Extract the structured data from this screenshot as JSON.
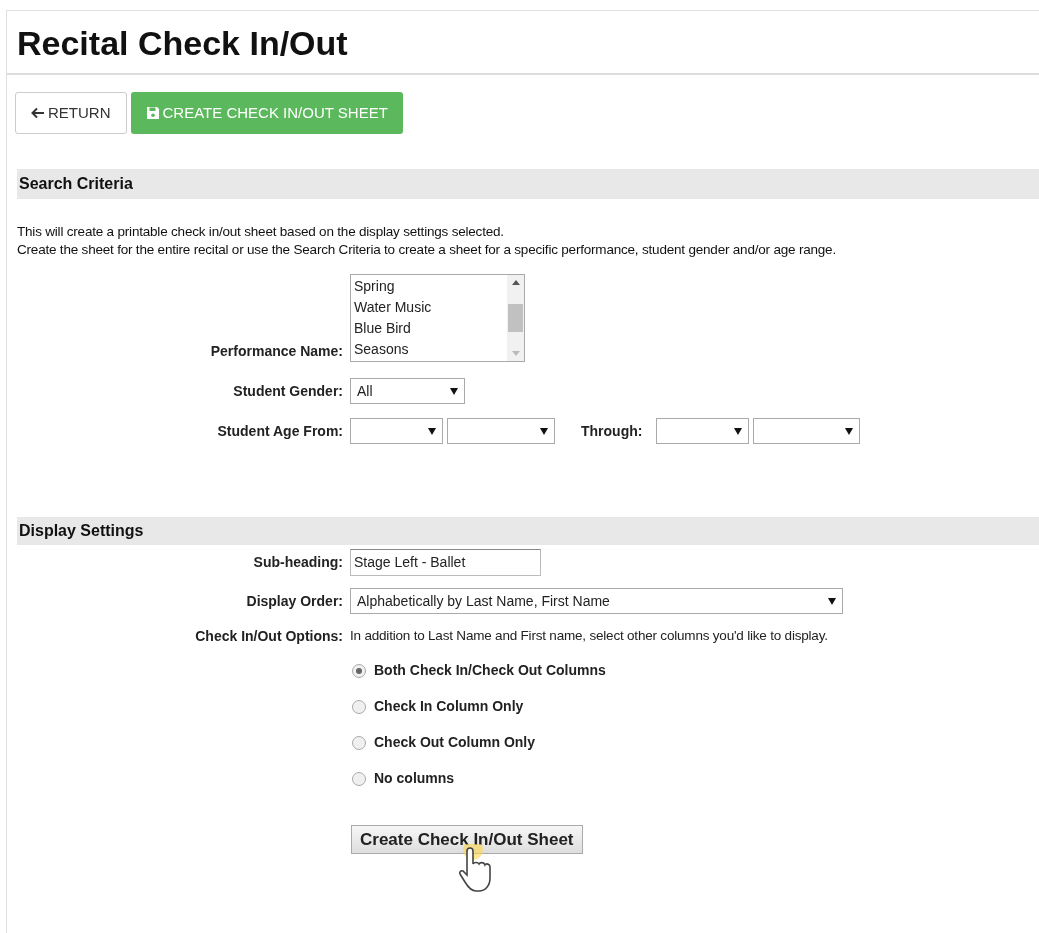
{
  "title": "Recital Check In/Out",
  "toolbar": [
    {
      "label": "RETURN",
      "kind": "back"
    },
    {
      "label": "CREATE CHECK IN/OUT SHEET",
      "kind": "save"
    }
  ],
  "search_criteria": {
    "heading": "Search Criteria",
    "description": [
      "This will create a printable check in/out sheet based on the display settings selected.",
      "Create the sheet for the entire recital or use the Search Criteria to create a sheet for a specific performance, student gender and/or age range."
    ],
    "performance_name": {
      "label": "Performance Name:",
      "options": [
        "Spring",
        "Water Music",
        "Blue Bird",
        "Seasons"
      ]
    },
    "student_gender": {
      "label": "Student Gender:",
      "value": "All"
    },
    "student_age": {
      "label": "Student Age From:",
      "through_label": "Through:"
    }
  },
  "display_settings": {
    "heading": "Display Settings",
    "sub_heading": {
      "label": "Sub-heading:",
      "value": "Stage Left - Ballet"
    },
    "display_order": {
      "label": "Display Order:",
      "value": "Alphabetically by Last Name, First Name"
    },
    "options": {
      "label": "Check In/Out Options:",
      "hint": "In addition to Last Name and First name, select other columns you'd like to display.",
      "choices": [
        {
          "label": "Both Check In/Check Out Columns",
          "selected": true
        },
        {
          "label": "Check In Column Only",
          "selected": false
        },
        {
          "label": "Check Out Column Only",
          "selected": false
        },
        {
          "label": "No columns",
          "selected": false
        }
      ]
    }
  },
  "submit_button": "Create Check In/Out Sheet"
}
